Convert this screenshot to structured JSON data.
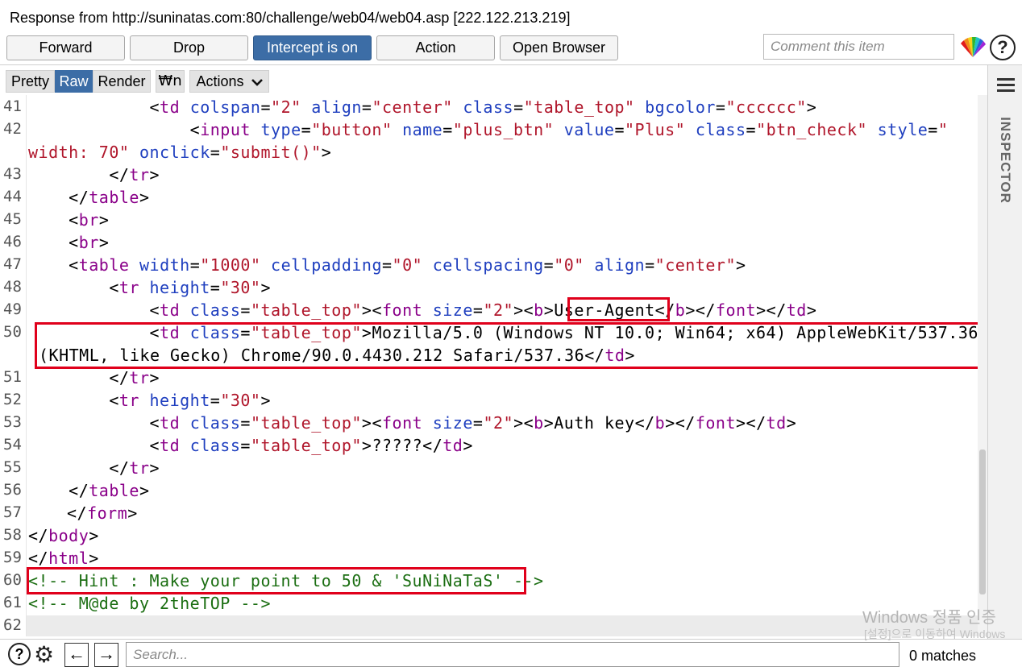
{
  "window": {
    "title": "Response from http://suninatas.com:80/challenge/web04/web04.asp   [222.122.213.219]"
  },
  "toolbar": {
    "forward": "Forward",
    "drop": "Drop",
    "intercept": "Intercept is on",
    "action": "Action",
    "open_browser": "Open Browser",
    "comment_placeholder": "Comment this item",
    "help": "?"
  },
  "tabs": {
    "pretty": "Pretty",
    "raw": "Raw",
    "render": "Render",
    "newline": "\\n",
    "actions": "Actions"
  },
  "editor": {
    "line_numbers": [
      "41",
      "42",
      "",
      "43",
      "44",
      "45",
      "46",
      "47",
      "48",
      "49",
      "50",
      "",
      "51",
      "52",
      "53",
      "54",
      "55",
      "56",
      "57",
      "58",
      "59",
      "60",
      "61",
      "62"
    ],
    "lines": {
      "l41": {
        "indent": "            ",
        "tag": "td",
        "a1": "colspan",
        "v1": "\"2\"",
        "a2": "align",
        "v2": "\"center\"",
        "a3": "class",
        "v3": "\"table_top\"",
        "a4": "bgcolor",
        "v4": "\"cccccc\""
      },
      "l42": {
        "indent": "                ",
        "tag": "input",
        "a1": "type",
        "v1": "\"button\"",
        "a2": "name",
        "v2": "\"plus_btn\"",
        "a3": "value",
        "v3": "\"Plus\"",
        "a4": "class",
        "v4": "\"btn_check\"",
        "a5": "style",
        "v5": "\""
      },
      "l42b": {
        "v1": "width: 70\"",
        "a1": "onclick",
        "v2": "\"submit()\""
      },
      "l43": {
        "indent": "        ",
        "tag": "tr"
      },
      "l44": {
        "indent": "    ",
        "tag": "table"
      },
      "l45": {
        "indent": "    ",
        "tag": "br"
      },
      "l46": {
        "indent": "    ",
        "tag": "br"
      },
      "l47": {
        "indent": "    ",
        "tag": "table",
        "a1": "width",
        "v1": "\"1000\"",
        "a2": "cellpadding",
        "v2": "\"0\"",
        "a3": "cellspacing",
        "v3": "\"0\"",
        "a4": "align",
        "v4": "\"center\""
      },
      "l48": {
        "indent": "        ",
        "tag": "tr",
        "a1": "height",
        "v1": "\"30\""
      },
      "l49": {
        "indent": "            ",
        "tag": "td",
        "a1": "class",
        "v1": "\"table_top\"",
        "tag2": "font",
        "a2": "size",
        "v2": "\"2\"",
        "tag3": "b",
        "text": "User-Agent"
      },
      "l50": {
        "indent": "            ",
        "tag": "td",
        "a1": "class",
        "v1": "\"table_top\"",
        "text": "Mozilla/5.0 (Windows NT 10.0; Win64; x64) AppleWebKit/537.36"
      },
      "l50b": {
        "text": "(KHTML, like Gecko) Chrome/90.0.4430.212 Safari/537.36",
        "tag": "td"
      },
      "l51": {
        "indent": "        ",
        "tag": "tr"
      },
      "l52": {
        "indent": "        ",
        "tag": "tr",
        "a1": "height",
        "v1": "\"30\""
      },
      "l53": {
        "indent": "            ",
        "tag": "td",
        "a1": "class",
        "v1": "\"table_top\"",
        "tag2": "font",
        "a2": "size",
        "v2": "\"2\"",
        "tag3": "b",
        "text": "Auth key"
      },
      "l54": {
        "indent": "            ",
        "tag": "td",
        "a1": "class",
        "v1": "\"table_top\"",
        "text": "?????"
      },
      "l55": {
        "indent": "        ",
        "tag": "tr"
      },
      "l56": {
        "indent": "    ",
        "tag": "table"
      },
      "l57": {
        "indent": "",
        "tag": "form"
      },
      "l58": {
        "tag": "body"
      },
      "l59": {
        "tag": "html"
      },
      "l60": {
        "comment": "<!-- Hint : Make your point to 50 & 'SuNiNaTaS' -->"
      },
      "l61": {
        "comment": "<!-- M@de by 2theTOP -->"
      }
    }
  },
  "inspector": {
    "label": "INSPECTOR"
  },
  "bottom": {
    "help": "?",
    "back": "←",
    "forward": "→",
    "search_placeholder": "Search...",
    "matches": "0 matches"
  },
  "watermark": {
    "line1": "Windows 정품 인증",
    "line2": "[설정]으로 이동하여 Windows"
  },
  "colors": {
    "accent": "#3c6da6",
    "tag": "#8a0089",
    "attr": "#1f3fbf",
    "value": "#b0162b",
    "comment": "#1b6e12",
    "highlight_box": "#e0001b"
  }
}
